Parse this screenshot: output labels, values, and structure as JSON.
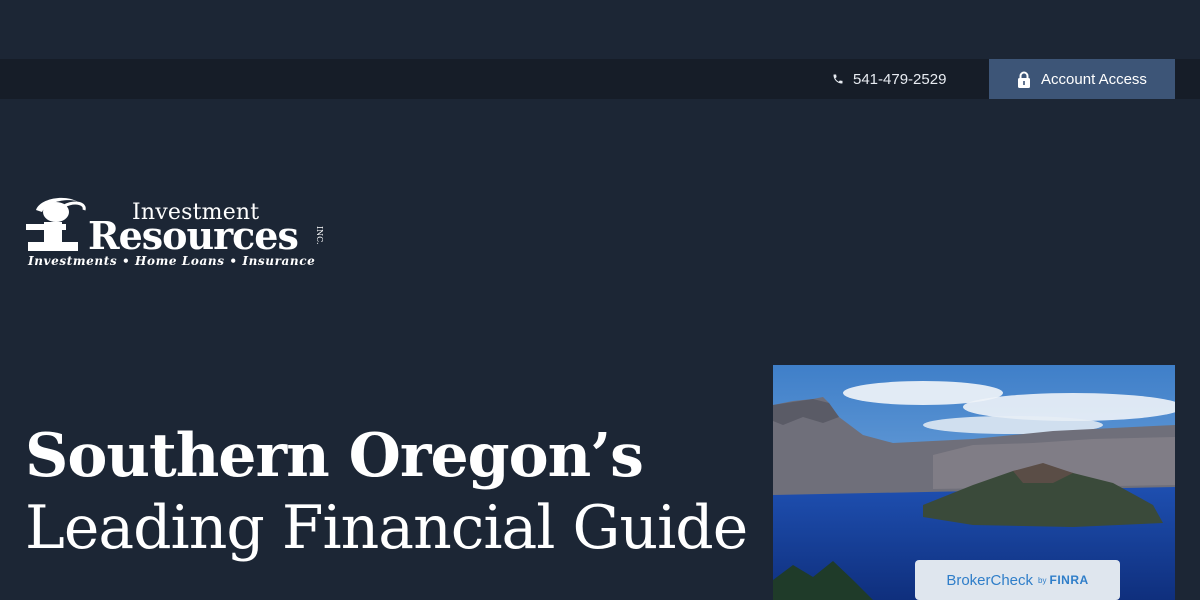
{
  "topbar": {
    "phone": "541-479-2529",
    "account_access": "Account Access"
  },
  "logo": {
    "line_top": "Investment",
    "line_main": "Resources",
    "inc": "INC.",
    "tagline": "Investments • Home Loans • Insurance"
  },
  "hero": {
    "line1": "Southern Oregon’s",
    "line2": "Leading Financial Guide"
  },
  "brokercheck": {
    "name": "BrokerCheck",
    "by": "by",
    "org": "FINRA"
  },
  "colors": {
    "background": "#1c2635",
    "topbar": "#161d28",
    "account_button": "#3d5577",
    "brokercheck_text": "#2f7ec9"
  },
  "icons": {
    "phone": "phone-icon",
    "lock": "lock-icon"
  }
}
